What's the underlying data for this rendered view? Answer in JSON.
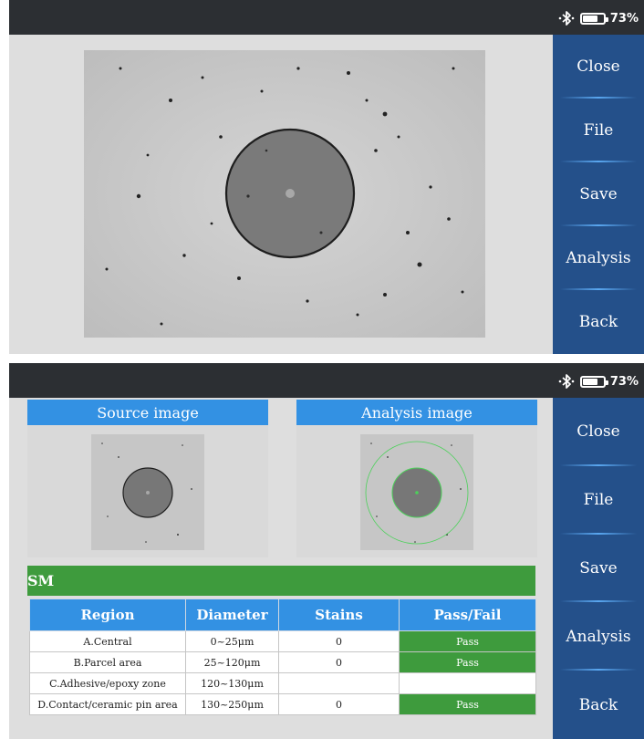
{
  "status": {
    "battery": "73%",
    "battery_level": 0.73
  },
  "sidebar": {
    "buttons": [
      {
        "label": "Close"
      },
      {
        "label": "File"
      },
      {
        "label": "Save"
      },
      {
        "label": "Analysis"
      },
      {
        "label": "Back"
      }
    ]
  },
  "analysis": {
    "source_title": "Source image",
    "analysis_title": "Analysis image",
    "fiber_type": "SM",
    "table": {
      "headers": [
        "Region",
        "Diameter",
        "Stains",
        "Pass/Fail"
      ],
      "rows": [
        {
          "region": "A.Central",
          "diameter": "0~25μm",
          "stains": "0",
          "result": "Pass"
        },
        {
          "region": "B.Parcel area",
          "diameter": "25~120μm",
          "stains": "0",
          "result": "Pass"
        },
        {
          "region": "C.Adhesive/epoxy zone",
          "diameter": "120~130μm",
          "stains": "",
          "result": ""
        },
        {
          "region": "D.Contact/ceramic pin area",
          "diameter": "130~250μm",
          "stains": "0",
          "result": "Pass"
        }
      ]
    }
  },
  "colors": {
    "sidebar": "#24508a",
    "header_blue": "#3391e3",
    "pass_green": "#3e9b3d",
    "statusbar": "#2c2f33"
  }
}
